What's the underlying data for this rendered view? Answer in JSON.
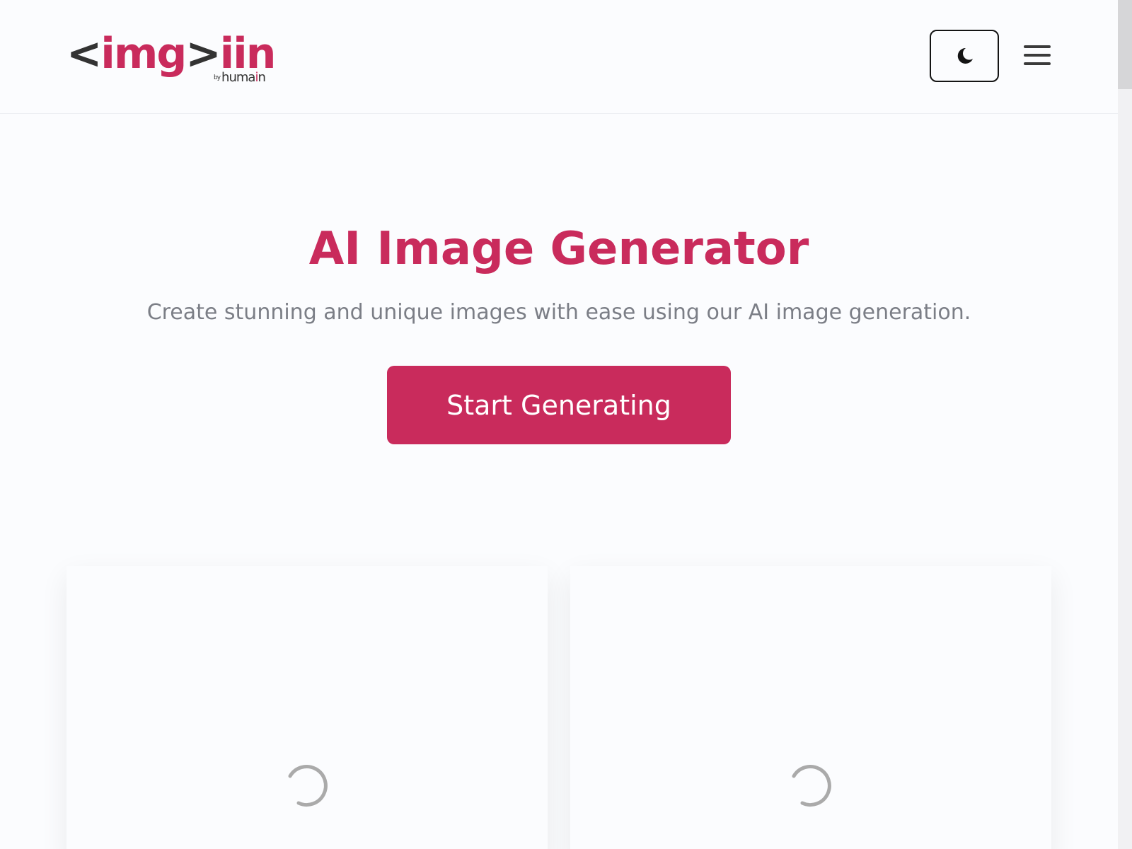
{
  "header": {
    "logo": {
      "bracket_open": "<",
      "word": "img",
      "bracket_close": ">",
      "suffix": "iin",
      "by": "by",
      "brand_start": "huma",
      "brand_accent": "i",
      "brand_end": "n"
    },
    "theme_toggle_icon": "moon-icon",
    "menu_icon": "hamburger-menu-icon"
  },
  "hero": {
    "title": "AI Image Generator",
    "subtitle": "Create stunning and unique images with ease using our AI image generation.",
    "cta_label": "Start Generating"
  },
  "gallery": {
    "cards": [
      {
        "state": "loading",
        "icon": "loading-spinner-icon"
      },
      {
        "state": "loading",
        "icon": "loading-spinner-icon"
      }
    ]
  },
  "colors": {
    "accent": "#c92b5c",
    "logo_dark": "#333333",
    "subtitle_text": "#7b7e86",
    "background": "#fbfcfe"
  }
}
